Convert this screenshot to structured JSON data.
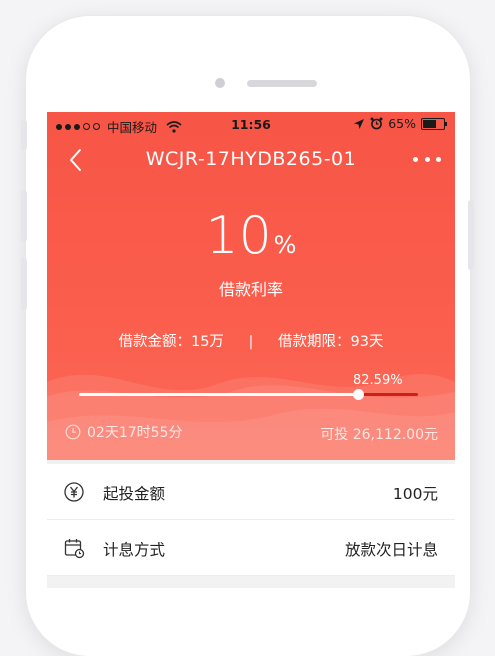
{
  "status_bar": {
    "carrier": "中国移动",
    "time": "11:56",
    "battery": "65%",
    "battery_level": 0.65
  },
  "nav": {
    "title": "WCJR-17HYDB265-01"
  },
  "rate": {
    "value": "10",
    "suffix": "%",
    "label": "借款利率"
  },
  "loan": {
    "amount": "借款金额：15万",
    "separator": "|",
    "term": "借款期限：93天"
  },
  "progress": {
    "label": "82.59%",
    "fraction": 0.8259
  },
  "countdown": "02天17时55分",
  "available": "可投 26,112.00元",
  "details": [
    {
      "label": "起投金额",
      "value": "100元",
      "icon": "yen-icon"
    },
    {
      "label": "计息方式",
      "value": "放款次日计息",
      "icon": "calendar-icon"
    }
  ],
  "colors": {
    "accent": "#fb5a4a",
    "progress_remaining": "#c8231b"
  }
}
